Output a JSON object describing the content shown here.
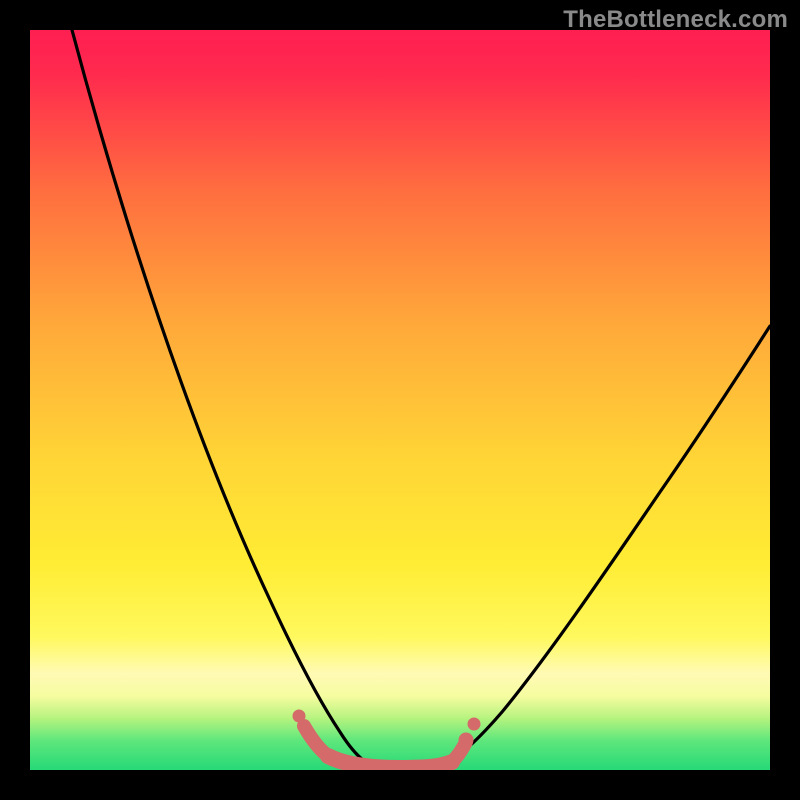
{
  "watermark": "TheBottleneck.com",
  "chart_data": {
    "type": "line",
    "title": "",
    "xlabel": "",
    "ylabel": "",
    "xlim": [
      0,
      100
    ],
    "ylim": [
      0,
      100
    ],
    "grid": false,
    "legend": false,
    "annotations": [],
    "series": [
      {
        "name": "curve-left",
        "x": [
          5,
          10,
          15,
          20,
          25,
          30,
          35,
          37,
          40,
          43,
          47
        ],
        "y": [
          100,
          88,
          75,
          62,
          50,
          37,
          24,
          17,
          9,
          3,
          0
        ]
      },
      {
        "name": "curve-right",
        "x": [
          55,
          58,
          62,
          68,
          75,
          82,
          90,
          98
        ],
        "y": [
          0,
          3,
          9,
          18,
          29,
          40,
          52,
          64
        ]
      },
      {
        "name": "bottom-marker-band",
        "type": "scatter",
        "x": [
          37,
          38,
          40,
          42,
          44,
          46,
          48,
          50,
          52,
          54,
          56,
          57,
          58
        ],
        "y": [
          3,
          2,
          1,
          0.5,
          0.3,
          0.2,
          0.2,
          0.2,
          0.2,
          0.3,
          1,
          2,
          3
        ]
      }
    ],
    "note": "Values estimated from pixel positions; no axis ticks, labels, or units are visible in the image."
  },
  "colors": {
    "frame": "#000000",
    "curve": "#000000",
    "marker": "#d86b6b",
    "gradient_top": "#ff1f52",
    "gradient_mid1": "#ff8e3a",
    "gradient_mid2": "#ffe736",
    "gradient_pale": "#fff7b8",
    "gradient_green": "#2fe07a"
  }
}
